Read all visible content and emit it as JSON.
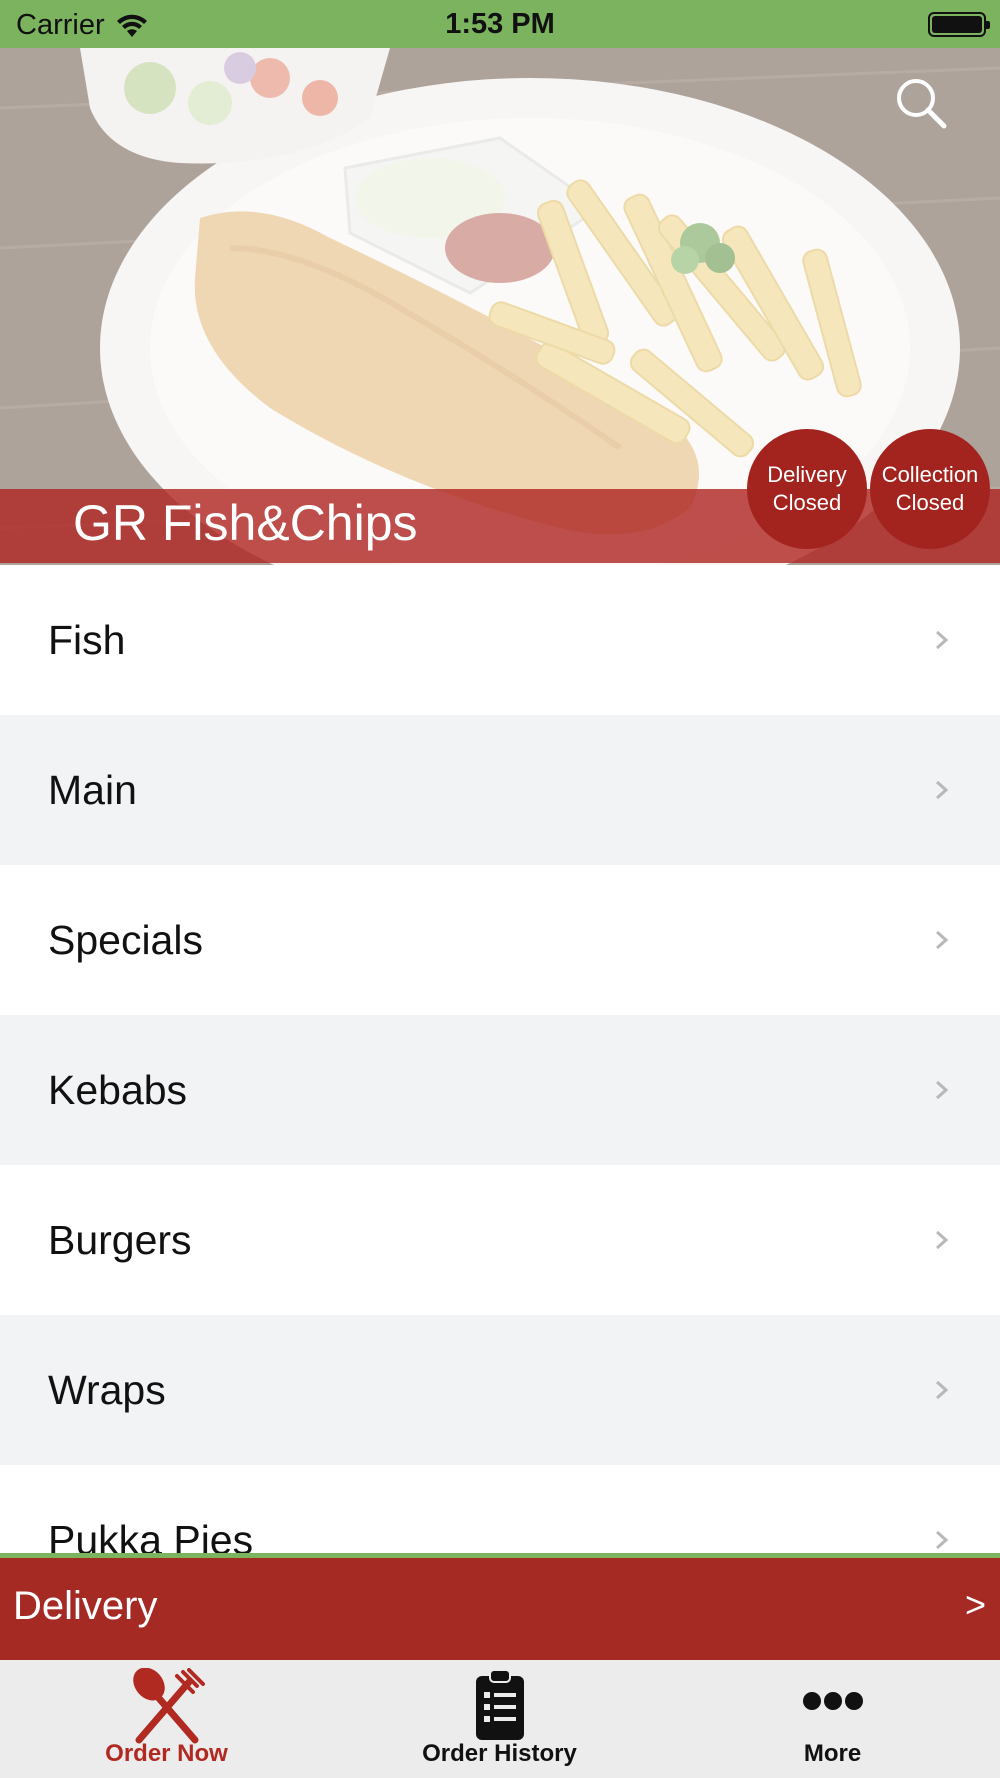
{
  "status_bar": {
    "carrier": "Carrier",
    "time": "1:53 PM"
  },
  "hero": {
    "restaurant_name": "GR Fish&Chips",
    "search_icon": "search-icon",
    "badges": {
      "delivery": {
        "line1": "Delivery",
        "line2": "Closed"
      },
      "collection": {
        "line1": "Collection",
        "line2": "Closed"
      }
    }
  },
  "menu": {
    "items": [
      {
        "label": "Fish"
      },
      {
        "label": "Main"
      },
      {
        "label": "Specials"
      },
      {
        "label": "Kebabs"
      },
      {
        "label": "Burgers"
      },
      {
        "label": "Wraps"
      },
      {
        "label": "Pukka Pies"
      }
    ],
    "chevron_icon": "chevron-right-icon"
  },
  "delivery_bar": {
    "label": "Delivery",
    "arrow": ">"
  },
  "tab_bar": {
    "tabs": [
      {
        "label": "Order Now",
        "icon": "fork-knife-icon",
        "active": true
      },
      {
        "label": "Order History",
        "icon": "clipboard-icon",
        "active": false
      },
      {
        "label": "More",
        "icon": "more-dots-icon",
        "active": false
      }
    ]
  },
  "colors": {
    "status_bar": "#7cb35f",
    "accent_red": "#a52a24",
    "active_tab": "#b12a22"
  }
}
